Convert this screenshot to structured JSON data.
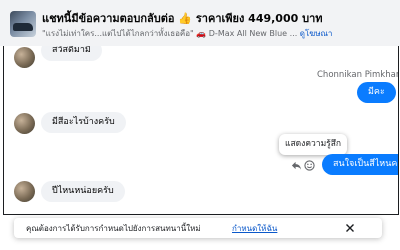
{
  "header": {
    "title": "แชทนี้มีข้อความตอบกลับต่อ 👍 ราคาเพียง 449,000 บาท",
    "subtitle": "\"แรงไม่เท่าใคร...แต่ไปได้ไกลกว่าทั้งเธอคือ\" 🚗 D-Max All New Blue ...",
    "subtitle_link": "ดูโฆษณา"
  },
  "messages": [
    {
      "direction": "in",
      "text": "สวัสดีมามี"
    },
    {
      "direction": "out",
      "sender": "Chonnikan Pimkham",
      "text": "มีคะ"
    },
    {
      "direction": "in",
      "text": "มีสีอะไรบ้างครับ"
    },
    {
      "direction": "out",
      "text": "สนใจเป็นสีไหนคะ",
      "tooltip": "แสดงความรู้สึก"
    },
    {
      "direction": "in",
      "text": "ปีไหนหน่อยครับ"
    }
  ],
  "icons": {
    "reply": "reply-icon",
    "react": "smiley-icon",
    "close": "close-icon"
  },
  "notice": {
    "message": "คุณต้องการได้รับการกำหนดไปยังการสนทนานี้ใหม่",
    "action": "กำหนดให้ฉัน"
  },
  "colors": {
    "outgoing_bubble": "#0a7cff",
    "incoming_bubble": "#f0f2f5",
    "header_bg": "#f2f3f5",
    "link": "#0a58ca"
  }
}
